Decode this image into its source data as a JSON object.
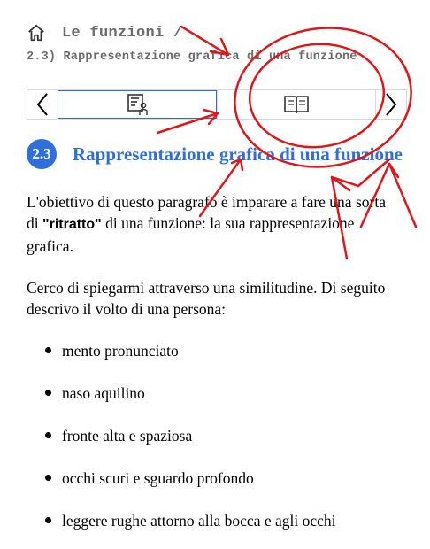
{
  "breadcrumb": {
    "title": "Le funzioni /",
    "subtitle": "2.3) Rappresentazione grafica di una funzione"
  },
  "nav": {
    "prev_icon": "chevron-left-icon",
    "next_icon": "chevron-right-icon",
    "tabs": [
      {
        "icon": "teacher-board-icon",
        "active": true
      },
      {
        "icon": "open-book-icon",
        "active": false
      }
    ]
  },
  "section": {
    "number": "2.3",
    "title": "Rappresentazione grafica di una funzione"
  },
  "paragraphs": {
    "p1_before": "L'obiettivo di questo paragrafo è imparare a fare una sorta di ",
    "p1_strong": "\"ritratto\"",
    "p1_after": " di una funzione: la sua rappresentazione grafica.",
    "p2": "Cerco di spiegarmi attraverso una similitudine. Di seguito descrivo il volto di una persona:"
  },
  "bullets": [
    "mento pronunciato",
    "naso aquilino",
    "fronte alta e spaziosa",
    "occhi scuri e sguardo profondo",
    "leggere rughe attorno alla bocca e agli occhi"
  ],
  "colors": {
    "accent": "#2e6fdb",
    "annotation": "#e0161b",
    "breadcrumb_text": "#6b6b6b"
  }
}
